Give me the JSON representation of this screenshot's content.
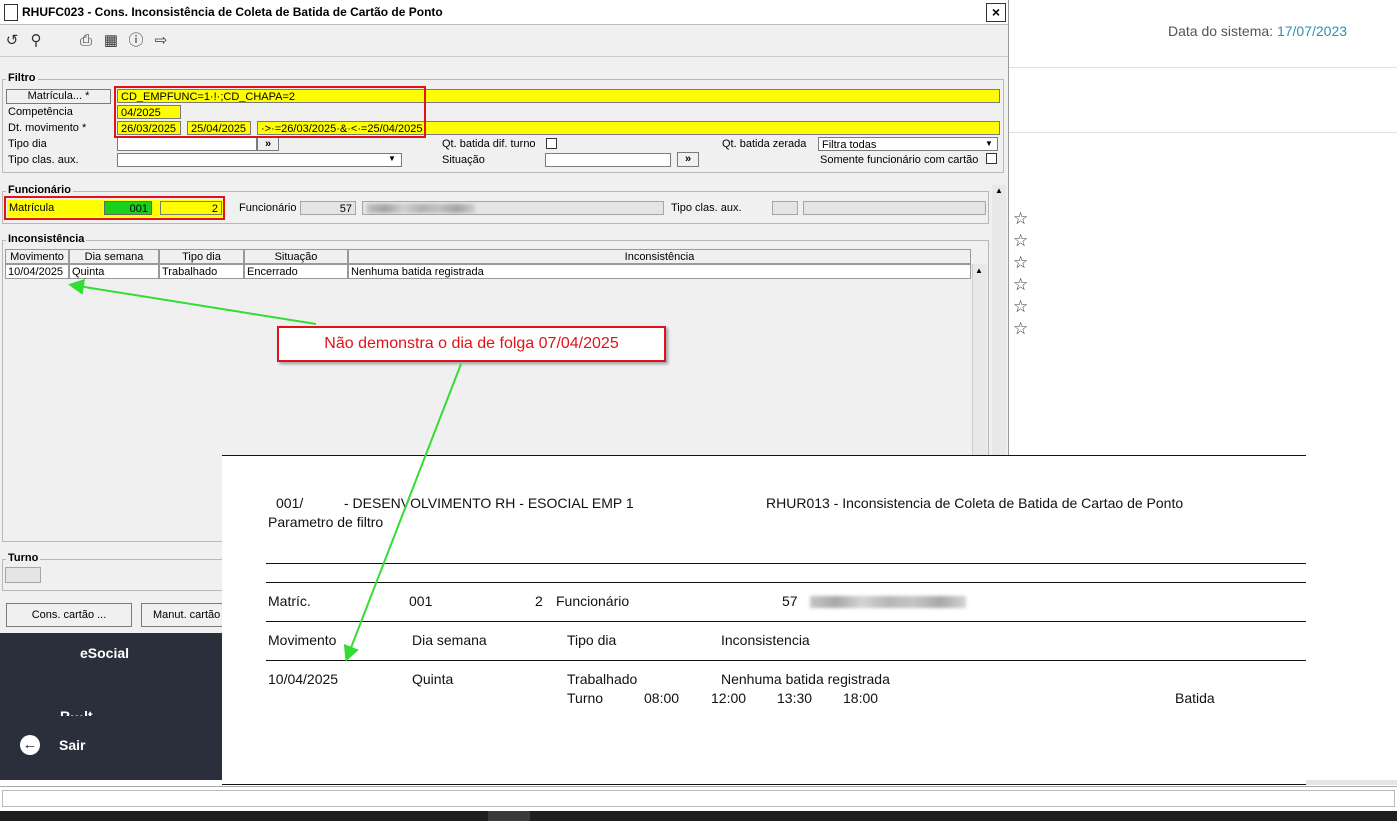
{
  "window": {
    "title": "RHUFC023 - Cons. Inconsistência de Coleta de Batida de Cartão de Ponto",
    "close_icon": "×"
  },
  "system_date": {
    "label": "Data do sistema:",
    "value": "17/07/2023"
  },
  "filtro": {
    "title": "Filtro",
    "matricula_btn": "Matrícula... *",
    "matricula_value": "CD_EMPFUNC=1·!·;CD_CHAPA=2",
    "competencia_label": "Competência",
    "competencia_value": "04/2025",
    "dt_movimento_label": "Dt. movimento *",
    "dt_inicio": "26/03/2025",
    "dt_fim": "25/04/2025",
    "dt_expr": "·>·=26/03/2025·&·<·=25/04/2025",
    "tipo_dia_label": "Tipo dia",
    "tipo_clas_aux_label": "Tipo clas. aux.",
    "qt_batida_dif_turno_label": "Qt. batida dif. turno",
    "situacao_label": "Situação",
    "qt_batida_zerada_label": "Qt. batida zerada",
    "qt_batida_zerada_value": "Filtra todas",
    "somente_func_cartao_label": "Somente funcionário com cartão",
    "lookup_btn": "»"
  },
  "funcionario": {
    "title": "Funcionário",
    "matricula_label": "Matrícula",
    "matricula_emp": "001",
    "matricula_chapa": "2",
    "funcionario_label": "Funcionário",
    "funcionario_code": "57",
    "tipo_clas_aux_label": "Tipo clas. aux."
  },
  "inconsistencia": {
    "title": "Inconsistência",
    "columns": [
      "Movimento",
      "Dia semana",
      "Tipo dia",
      "Situação",
      "Inconsistência"
    ],
    "rows": [
      {
        "movimento": "10/04/2025",
        "dia_semana": "Quinta",
        "tipo_dia": "Trabalhado",
        "situacao": "Encerrado",
        "inconsistencia": "Nenhuma batida registrada"
      }
    ]
  },
  "turno": {
    "title": "Turno"
  },
  "buttons": {
    "cons_cartao": "Cons. cartão ...",
    "manut_cartao": "Manut. cartão ..."
  },
  "sidebar": {
    "esocial": "eSocial",
    "partial": "R···lt",
    "sair": "Sair"
  },
  "annotation": {
    "text": "Não demonstra o dia de folga 07/04/2025"
  },
  "report": {
    "emp_code": "001/",
    "emp_name": "- DESENVOLVIMENTO RH - ESOCIAL EMP 1",
    "report_title": "RHUR013 - Inconsistencia de Coleta de Batida de Cartao de Ponto",
    "param_label": "Parametro de filtro",
    "matric_label": "Matríc.",
    "matric_emp": "001",
    "matric_chapa": "2",
    "funcionario_label": "Funcionário",
    "funcionario_code": "57",
    "hdr_movimento": "Movimento",
    "hdr_dia_semana": "Dia semana",
    "hdr_tipo_dia": "Tipo dia",
    "hdr_inconsistencia": "Inconsistencia",
    "row_movimento": "10/04/2025",
    "row_dia_semana": "Quinta",
    "row_tipo_dia": "Trabalhado",
    "row_inconsistencia": "Nenhuma batida registrada",
    "turno_label": "Turno",
    "turno_times": [
      "08:00",
      "12:00",
      "13:30",
      "18:00"
    ],
    "batida_label": "Batida"
  },
  "colors": {
    "accent": "#2f8fb5",
    "highlight": "#ffff00",
    "annotation_red": "#e0121a",
    "arrow_green": "#33dd33",
    "sidebar_bg": "#2b2f3c"
  }
}
